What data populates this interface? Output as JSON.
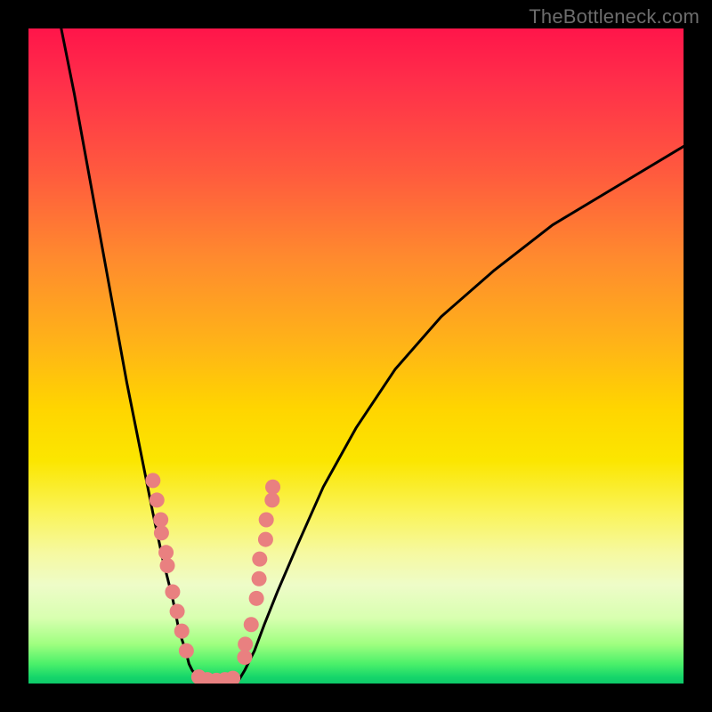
{
  "watermark": "TheBottleneck.com",
  "colors": {
    "background_frame": "#000000",
    "curve_stroke": "#000000",
    "marker_fill": "#e98080",
    "gradient_top": "#ff154a",
    "gradient_bottom": "#0ec96a"
  },
  "chart_data": {
    "type": "line",
    "title": "",
    "xlabel": "",
    "ylabel": "",
    "xlim": [
      0,
      100
    ],
    "ylim": [
      0,
      100
    ],
    "note": "Axes have no visible tick labels; values are approximate pixel-space normalized to 0–100.",
    "series": [
      {
        "name": "left-curve",
        "x": [
          5,
          7,
          9,
          11,
          13,
          15,
          17,
          19,
          20.5,
          22,
          23,
          24,
          24.5,
          25,
          25.8,
          26.5,
          27
        ],
        "y": [
          100,
          90,
          79,
          68,
          57,
          46,
          36,
          26,
          19,
          13,
          8,
          5,
          3,
          2,
          1,
          0.5,
          0
        ]
      },
      {
        "name": "valley-floor",
        "x": [
          27,
          28,
          29,
          30,
          31,
          31.8
        ],
        "y": [
          0,
          0,
          0,
          0,
          0,
          0
        ]
      },
      {
        "name": "right-curve",
        "x": [
          31.8,
          33,
          34.5,
          36,
          38,
          41,
          45,
          50,
          56,
          63,
          71,
          80,
          90,
          100
        ],
        "y": [
          0,
          2,
          5,
          9,
          14,
          21,
          30,
          39,
          48,
          56,
          63,
          70,
          76,
          82
        ]
      }
    ],
    "markers": {
      "name": "highlighted-points",
      "note": "Pink circular markers clustered near the valley on both inner walls and along the floor.",
      "points": [
        {
          "x": 19.0,
          "y": 31
        },
        {
          "x": 19.6,
          "y": 28
        },
        {
          "x": 20.2,
          "y": 25
        },
        {
          "x": 20.3,
          "y": 23
        },
        {
          "x": 21.0,
          "y": 20
        },
        {
          "x": 21.2,
          "y": 18
        },
        {
          "x": 22.0,
          "y": 14
        },
        {
          "x": 22.7,
          "y": 11
        },
        {
          "x": 23.4,
          "y": 8
        },
        {
          "x": 24.1,
          "y": 5
        },
        {
          "x": 26.0,
          "y": 1
        },
        {
          "x": 27.3,
          "y": 0.6
        },
        {
          "x": 28.7,
          "y": 0.5
        },
        {
          "x": 30.0,
          "y": 0.6
        },
        {
          "x": 31.2,
          "y": 0.8
        },
        {
          "x": 33.0,
          "y": 4
        },
        {
          "x": 33.1,
          "y": 6
        },
        {
          "x": 34.0,
          "y": 9
        },
        {
          "x": 34.8,
          "y": 13
        },
        {
          "x": 35.2,
          "y": 16
        },
        {
          "x": 35.3,
          "y": 19
        },
        {
          "x": 36.2,
          "y": 22
        },
        {
          "x": 36.3,
          "y": 25
        },
        {
          "x": 37.2,
          "y": 28
        },
        {
          "x": 37.3,
          "y": 30
        }
      ]
    }
  }
}
